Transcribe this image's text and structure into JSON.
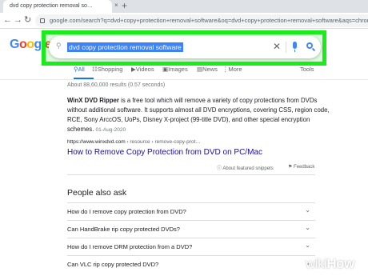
{
  "browser": {
    "tab_title": "dvd copy protection removal so…",
    "tab_close": "×",
    "new_tab": "+",
    "back": "←",
    "forward": "→",
    "reload": "↻",
    "url": "google.com/search?q=dvd+copy+protection+removal+software&oq=dvd+copy+protection+removal+software&aqs=chrome..69i57j0"
  },
  "google": {
    "logo": {
      "g": "G",
      "o1": "o",
      "o2": "o",
      "g2": "g",
      "l": "l",
      "e": "e"
    }
  },
  "search": {
    "query": "dvd copy protection removal software",
    "clear_icon": "close-icon",
    "mic_icon": "mic-icon",
    "search_icon": "search-icon"
  },
  "tabs": {
    "all": "All",
    "shopping": "Shopping",
    "videos": "Videos",
    "images": "Images",
    "news": "News",
    "more": "More",
    "tools": "Tools"
  },
  "results": {
    "stats": "About 88,60,000 results (0.57 seconds)",
    "featured": {
      "bold": "WinX DVD Ripper",
      "text": " is a free tool which will remove a variety of copy protections from DVDs without additional software. It supports almost all DVD encryptions, covering CSS, region code, RCE, Sony ArccOS, UoPs, Disney X-project (99-title DVD), and other special encryption schemes.",
      "date": "01-Aug-2020",
      "cite_domain": "https://www.winxdvd.com",
      "cite_path": " › resource › remove-copy-prot…",
      "title": "How to Remove Copy Protection from DVD on PC/Mac",
      "about": "About featured snippets",
      "feedback": "Feedback"
    }
  },
  "people_also_ask": {
    "title": "People also ask",
    "questions": [
      "How do I remove copy protection from DVD?",
      "Can HandBrake rip copy protected DVDs?",
      "How do I remove DRM protection from a DVD?",
      "Can VLC rip copy protected DVD?"
    ]
  },
  "watermark": {
    "wiki": "wiki",
    "how": "How"
  },
  "colors": {
    "highlight": "#1aeb1a",
    "link": "#1a0dab",
    "accent": "#1a73e8",
    "selection": "#3e82f7"
  }
}
